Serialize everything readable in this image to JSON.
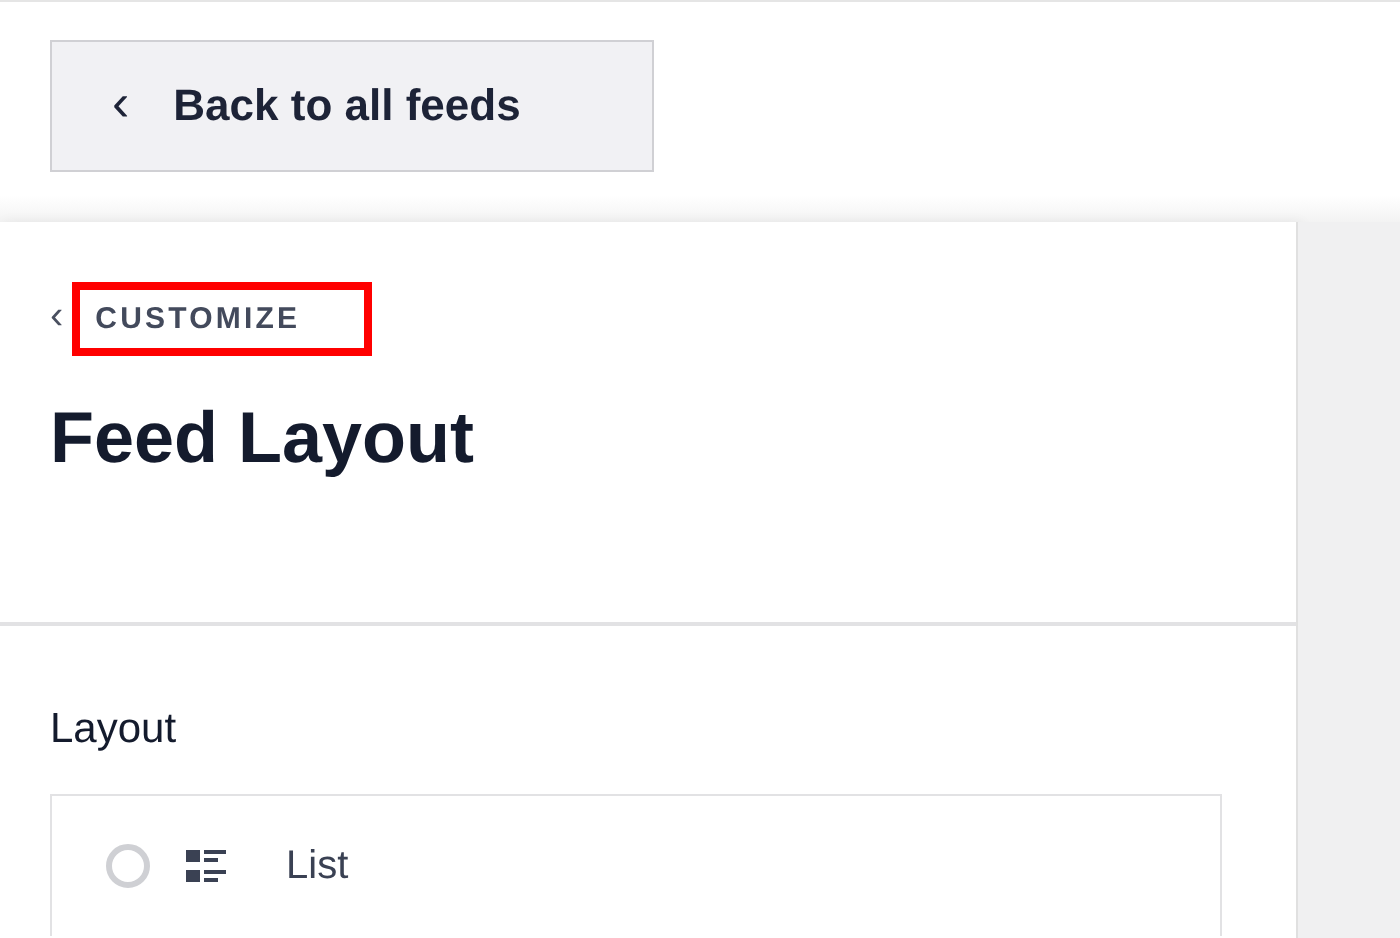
{
  "back_button": {
    "icon": "‹",
    "label": "Back to all feeds"
  },
  "breadcrumb": {
    "label": "CUSTOMIZE",
    "highlighted": true
  },
  "title": "Feed Layout",
  "section": {
    "label": "Layout",
    "options": [
      {
        "label": "List",
        "selected": false
      }
    ]
  }
}
